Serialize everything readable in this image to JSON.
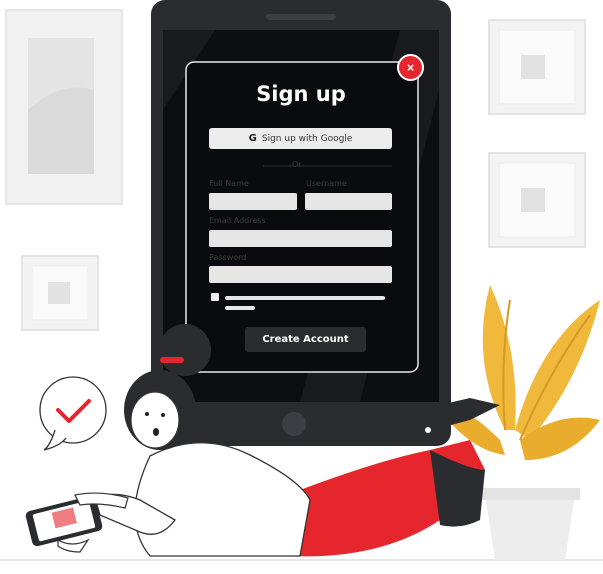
{
  "form": {
    "title": "Sign up",
    "google_button": "Sign up with Google",
    "google_icon": "G",
    "divider_text": "Or",
    "full_name_label": "Full Name",
    "username_label": "Username",
    "email_label": "Email Address",
    "password_label": "Password",
    "create_button": "Create Account",
    "close_icon": "×"
  },
  "colors": {
    "accent_red": "#e5262d",
    "tablet_dark": "#2b2c30",
    "plant_yellow": "#f0b93b"
  }
}
